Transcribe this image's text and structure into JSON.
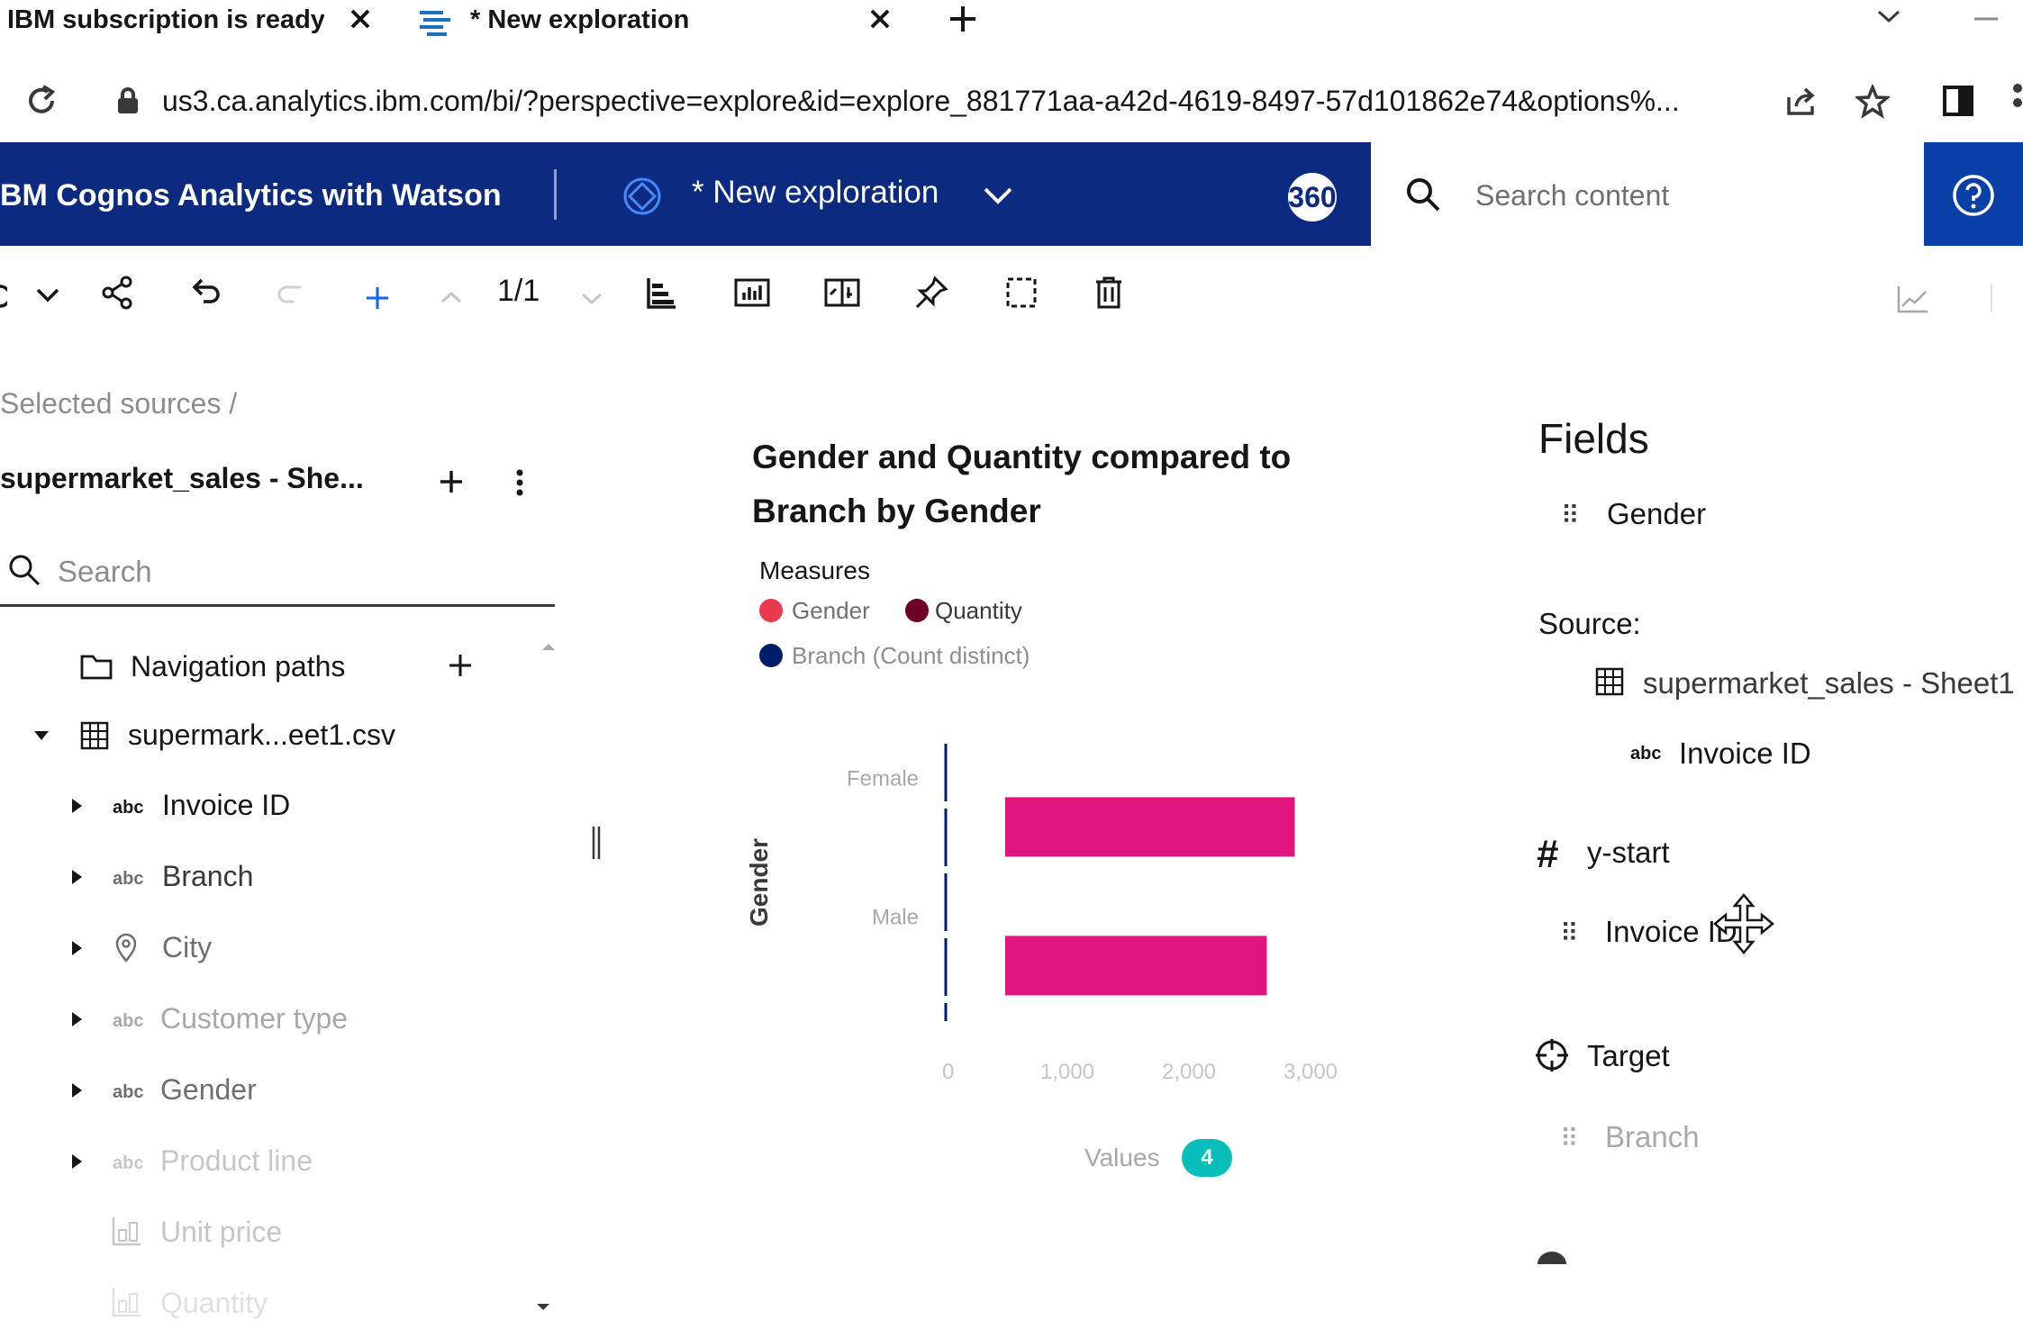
{
  "browser": {
    "tabs": [
      {
        "title": "IBM subscription is ready to",
        "active": false
      },
      {
        "title": "* New exploration",
        "active": true
      }
    ],
    "url": "us3.ca.analytics.ibm.com/bi/?perspective=explore&id=explore_881771aa-a42d-4619-8497-57d101862e74&options%..."
  },
  "header": {
    "app_title": "BM Cognos Analytics with Watson",
    "exploration_title": "* New exploration",
    "avatar_text": "360",
    "search_placeholder": "Search content"
  },
  "toolbar": {
    "page_counter": "1/1"
  },
  "left_panel": {
    "breadcrumb": "Selected sources  /",
    "source_name": "supermarket_sales - She...",
    "search_placeholder": "Search",
    "navigation_paths_label": "Navigation paths",
    "file_label": "supermark...eet1.csv",
    "items": [
      {
        "label": "Invoice ID",
        "type": "abc"
      },
      {
        "label": "Branch",
        "type": "abc"
      },
      {
        "label": "City",
        "type": "geo"
      },
      {
        "label": "Customer type",
        "type": "abc"
      },
      {
        "label": "Gender",
        "type": "abc"
      },
      {
        "label": "Product line",
        "type": "abc"
      },
      {
        "label": "Unit price",
        "type": "measure"
      },
      {
        "label": "Quantity",
        "type": "measure"
      }
    ]
  },
  "chart": {
    "title": "Gender and Quantity compared to Branch by Gender",
    "measures_label": "Measures",
    "legend": [
      {
        "name": "Gender",
        "color": "#e8394f"
      },
      {
        "name": "Quantity",
        "color": "#6e0026"
      },
      {
        "name": "Branch (Count distinct)",
        "color": "#001d6c"
      }
    ],
    "values_label": "Values",
    "values_count": "4"
  },
  "chart_data": {
    "type": "bar",
    "orientation": "horizontal",
    "categories": [
      "Female",
      "Male"
    ],
    "series": [
      {
        "name": "Quantity",
        "values": [
          2870,
          2640
        ]
      }
    ],
    "ylabel": "Gender",
    "xlabel": "Values",
    "x_ticks": [
      "0",
      "1,000",
      "2,000",
      "3,000"
    ],
    "xlim": [
      0,
      3000
    ],
    "bar_color": "#e0157f"
  },
  "right_panel": {
    "fields_title": "Fields",
    "gender_field": "Gender",
    "source_label": "Source:",
    "source_table": "supermarket_sales - Sheet1",
    "source_field": "Invoice ID",
    "ystart_label": "y-start",
    "ystart_field": "Invoice ID",
    "target_label": "Target",
    "target_field": "Branch"
  },
  "colors": {
    "header_bg": "#0b2a80",
    "accent": "#0f62fe",
    "badge": "#08bdba"
  }
}
